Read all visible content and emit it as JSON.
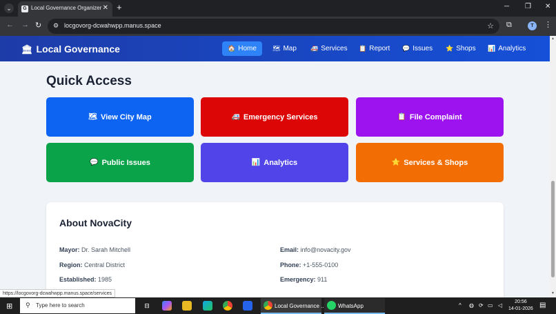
{
  "browser": {
    "tab_title": "Local Governance Organizer",
    "tab_favicon": "G",
    "close_tab": "✕",
    "new_tab": "+",
    "url": "locgovorg-dcwahwpp.manus.space",
    "profile_initial": "T",
    "status_url": "https://locgovorg-dcwahwpp.manus.space/services",
    "icons": [
      "tab-search-icon",
      "back-icon",
      "forward-icon",
      "reload-icon",
      "site-info-icon",
      "bookmark-star-icon",
      "extensions-icon",
      "menu-icon",
      "minimize-icon",
      "maximize-icon",
      "close-icon"
    ]
  },
  "app": {
    "brand": "Local Governance",
    "brand_icon": "🏛",
    "nav": [
      {
        "label": "Home",
        "icon": "🏠",
        "active": true
      },
      {
        "label": "Map",
        "icon": "🗺"
      },
      {
        "label": "Services",
        "icon": "🚑"
      },
      {
        "label": "Report",
        "icon": "📋"
      },
      {
        "label": "Issues",
        "icon": "💬"
      },
      {
        "label": "Shops",
        "icon": "⭐"
      },
      {
        "label": "Analytics",
        "icon": "📊"
      }
    ]
  },
  "quick_access": {
    "title": "Quick Access",
    "cards": [
      {
        "label": "View City Map",
        "icon": "🗺",
        "color": "#0d64f2"
      },
      {
        "label": "Emergency Services",
        "icon": "🚑",
        "color": "#dc0606"
      },
      {
        "label": "File Complaint",
        "icon": "📋",
        "color": "#9c13f0"
      },
      {
        "label": "Public Issues",
        "icon": "💬",
        "color": "#0aa34a"
      },
      {
        "label": "Analytics",
        "icon": "📊",
        "color": "#5145ea"
      },
      {
        "label": "Services & Shops",
        "icon": "⭐",
        "color": "#f26e05"
      }
    ]
  },
  "about": {
    "title": "About NovaCity",
    "left": [
      {
        "key": "Mayor:",
        "value": "Dr. Sarah Mitchell"
      },
      {
        "key": "Region:",
        "value": "Central District"
      },
      {
        "key": "Established:",
        "value": "1985"
      }
    ],
    "right": [
      {
        "key": "Email:",
        "value": "info@novacity.gov"
      },
      {
        "key": "Phone:",
        "value": "+1-555-0100"
      },
      {
        "key": "Emergency:",
        "value": "911"
      }
    ]
  },
  "taskbar": {
    "search_placeholder": "Type here to search",
    "apps": [
      {
        "label": "Local Governance ...",
        "icon": "chrome-icon"
      },
      {
        "label": "WhatsApp",
        "icon": "whatsapp-icon"
      }
    ],
    "time": "20:56",
    "date": "14-01-2026"
  }
}
